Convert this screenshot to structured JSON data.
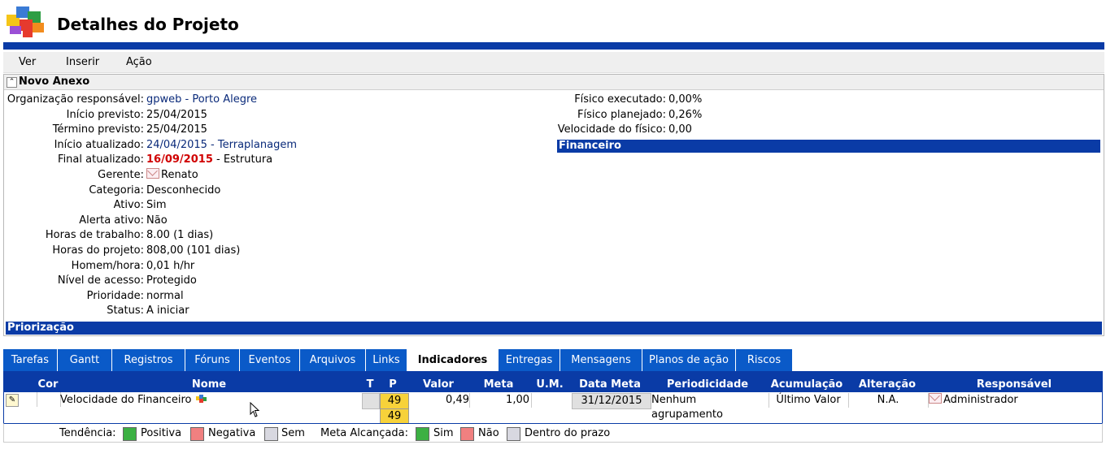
{
  "header": {
    "title": "Detalhes do Projeto"
  },
  "menu": {
    "items": [
      "Ver",
      "Inserir",
      "Ação"
    ]
  },
  "panel": {
    "title": "Novo Anexo",
    "left_fields": [
      {
        "label": "Organização responsável:",
        "value": "gpweb - Porto Alegre"
      },
      {
        "label": "Início previsto:",
        "value": "25/04/2015"
      },
      {
        "label": "Término previsto:",
        "value": "25/04/2015"
      },
      {
        "label": "Início atualizado:",
        "value": "24/04/2015 - Terraplanagem"
      },
      {
        "label": "Final atualizado:",
        "value_red": "16/09/2015",
        "value_rest": " - Estrutura"
      },
      {
        "label": "Gerente:",
        "value": "Renato"
      },
      {
        "label": "Categoria:",
        "value": "Desconhecido"
      },
      {
        "label": "Ativo:",
        "value": "Sim"
      },
      {
        "label": "Alerta ativo:",
        "value": "Não"
      },
      {
        "label": "Horas de trabalho:",
        "value": "8.00 (1 dias)"
      },
      {
        "label": "Horas do projeto:",
        "value": "808,00 (101 dias)"
      },
      {
        "label": "Homem/hora:",
        "value": "0,01 h/hr"
      },
      {
        "label": "Nível de acesso:",
        "value": "Protegido"
      },
      {
        "label": "Prioridade:",
        "value": "normal"
      },
      {
        "label": "Status:",
        "value": "A iniciar"
      }
    ],
    "right_fields": [
      {
        "label": "Físico executado:",
        "value": "0,00%"
      },
      {
        "label": "Físico planejado:",
        "value": "0,26%"
      },
      {
        "label": "Velocidade do físico:",
        "value": "0,00"
      }
    ],
    "financeiro_title": "Financeiro",
    "priorizacao_title": "Priorização"
  },
  "tabs": [
    "Tarefas",
    "Gantt",
    "Registros",
    "Fóruns",
    "Eventos",
    "Arquivos",
    "Links",
    "Indicadores",
    "Entregas",
    "Mensagens",
    "Planos de ação",
    "Riscos"
  ],
  "active_tab": "Indicadores",
  "table": {
    "headers": {
      "cor": "Cor",
      "nome": "Nome",
      "t": "T",
      "p": "P",
      "valor": "Valor",
      "meta": "Meta",
      "um": "U.M.",
      "data_meta": "Data Meta",
      "periodicidade": "Periodicidade",
      "acumulacao": "Acumulação",
      "alteracao": "Alteração",
      "responsavel": "Responsável"
    },
    "row": {
      "nome": "Velocidade do Financeiro",
      "p": "49",
      "p2": "49",
      "valor": "0,49",
      "meta": "1,00",
      "um": "",
      "data_meta": "31/12/2015",
      "periodicidade": "Nenhum agrupamento",
      "acumulacao": "Último Valor",
      "alteracao": "N.A.",
      "responsavel": "Administrador"
    }
  },
  "legend": {
    "tendencia": "Tendência:",
    "positiva": "Positiva",
    "negativa": "Negativa",
    "sem": "Sem",
    "meta_alcancada": "Meta Alcançada:",
    "sim": "Sim",
    "nao": "Não",
    "dentro": "Dentro do prazo",
    "colors": {
      "green": "#3cb043",
      "red": "#f08080",
      "grey": "#d8d8e0"
    }
  },
  "colors": {
    "brand_blue": "#0a3ba6",
    "tab_blue": "#0a5ac8",
    "yellow": "#f7d23a"
  }
}
